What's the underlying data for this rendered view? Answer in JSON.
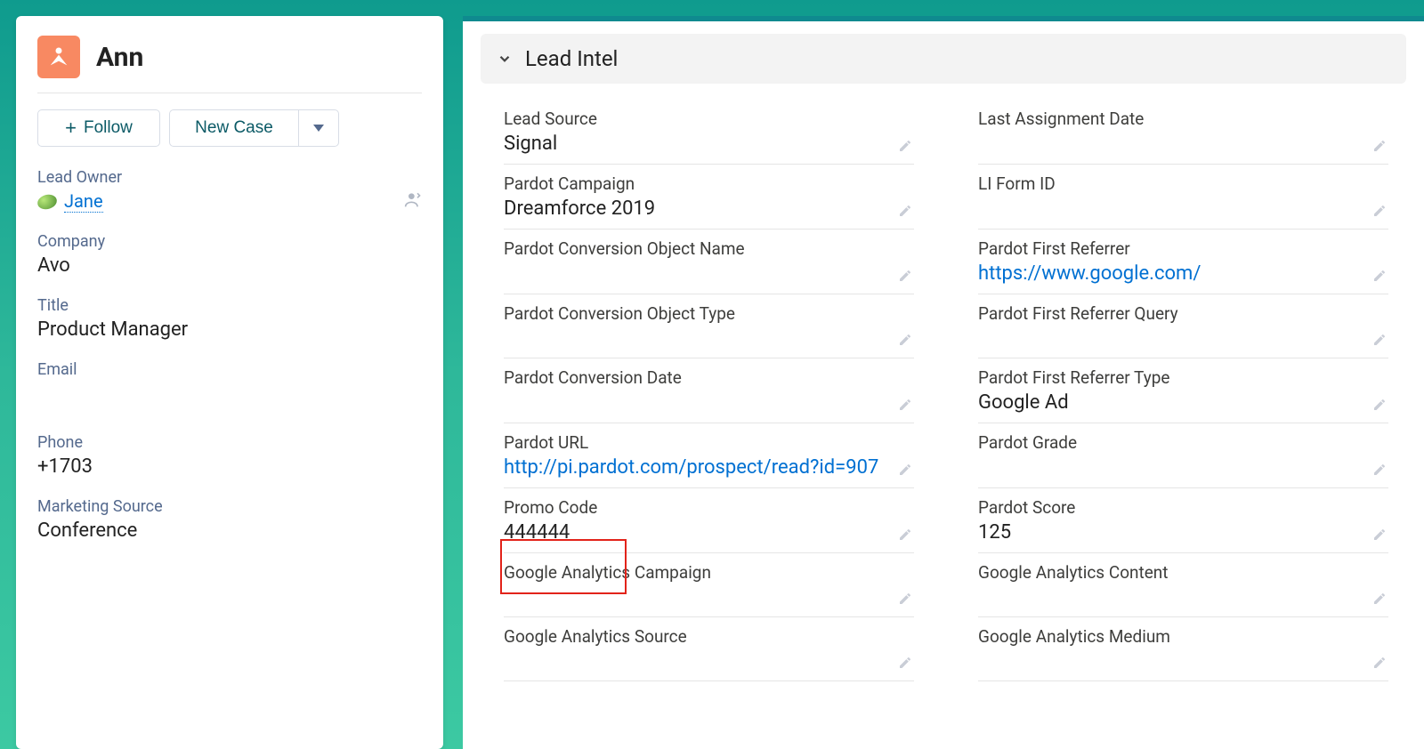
{
  "lead": {
    "name": "Ann",
    "actions": {
      "follow": "Follow",
      "newCase": "New Case"
    },
    "fields": {
      "leadOwner": {
        "label": "Lead Owner",
        "value": "Jane"
      },
      "company": {
        "label": "Company",
        "value": "Avo"
      },
      "title": {
        "label": "Title",
        "value": "Product Manager"
      },
      "email": {
        "label": "Email",
        "value": ""
      },
      "phone": {
        "label": "Phone",
        "value": "+1703"
      },
      "marketingSource": {
        "label": "Marketing Source",
        "value": "Conference"
      }
    }
  },
  "section": {
    "title": "Lead Intel",
    "left": [
      {
        "label": "Lead Source",
        "value": "Signal",
        "link": false
      },
      {
        "label": "Pardot Campaign",
        "value": "Dreamforce 2019",
        "link": false
      },
      {
        "label": "Pardot Conversion Object Name",
        "value": "",
        "link": false
      },
      {
        "label": "Pardot Conversion Object Type",
        "value": "",
        "link": false
      },
      {
        "label": "Pardot Conversion Date",
        "value": "",
        "link": false
      },
      {
        "label": "Pardot URL",
        "value": "http://pi.pardot.com/prospect/read?id=907",
        "link": true
      },
      {
        "label": "Promo Code",
        "value": "444444",
        "link": false
      },
      {
        "label": "Google Analytics Campaign",
        "value": "",
        "link": false
      },
      {
        "label": "Google Analytics Source",
        "value": "",
        "link": false
      }
    ],
    "right": [
      {
        "label": "Last Assignment Date",
        "value": "",
        "link": false
      },
      {
        "label": "LI Form ID",
        "value": "",
        "link": false
      },
      {
        "label": "Pardot First Referrer",
        "value": "https://www.google.com/",
        "link": true
      },
      {
        "label": "Pardot First Referrer Query",
        "value": "",
        "link": false
      },
      {
        "label": "Pardot First Referrer Type",
        "value": "Google Ad",
        "link": false
      },
      {
        "label": "Pardot Grade",
        "value": "",
        "link": false
      },
      {
        "label": "Pardot Score",
        "value": "125",
        "link": false
      },
      {
        "label": "Google Analytics Content",
        "value": "",
        "link": false
      },
      {
        "label": "Google Analytics Medium",
        "value": "",
        "link": false
      }
    ]
  }
}
